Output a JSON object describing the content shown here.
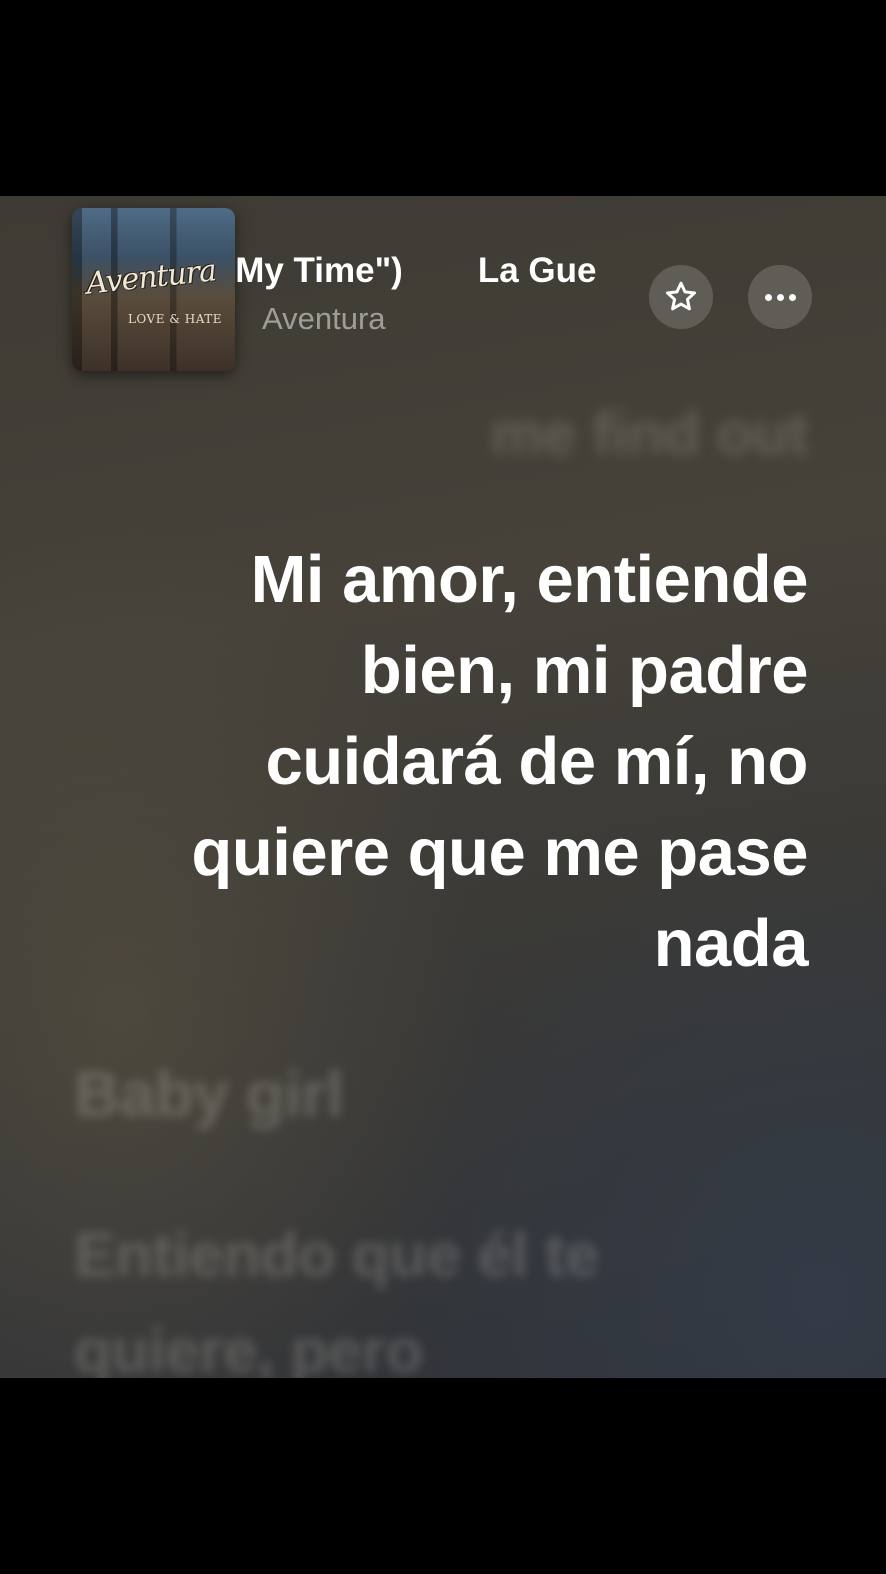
{
  "now_playing": {
    "album_art_title": "Aventura",
    "album_art_subtitle": "LOVE & HATE",
    "title_text": "e My Time\")",
    "title_next_text": "La Gue",
    "artist": "Aventura"
  },
  "buttons": {
    "favorite_icon": "star-outline",
    "more_icon": "ellipsis"
  },
  "lyrics": {
    "previous_line": "me find out",
    "current_line": "Mi amor, entiende bien, mi padre cuidará de mí, no quiere que me pase nada",
    "next_line": "Baby girl",
    "following_line": "Entiendo que él te quiere, pero"
  }
}
